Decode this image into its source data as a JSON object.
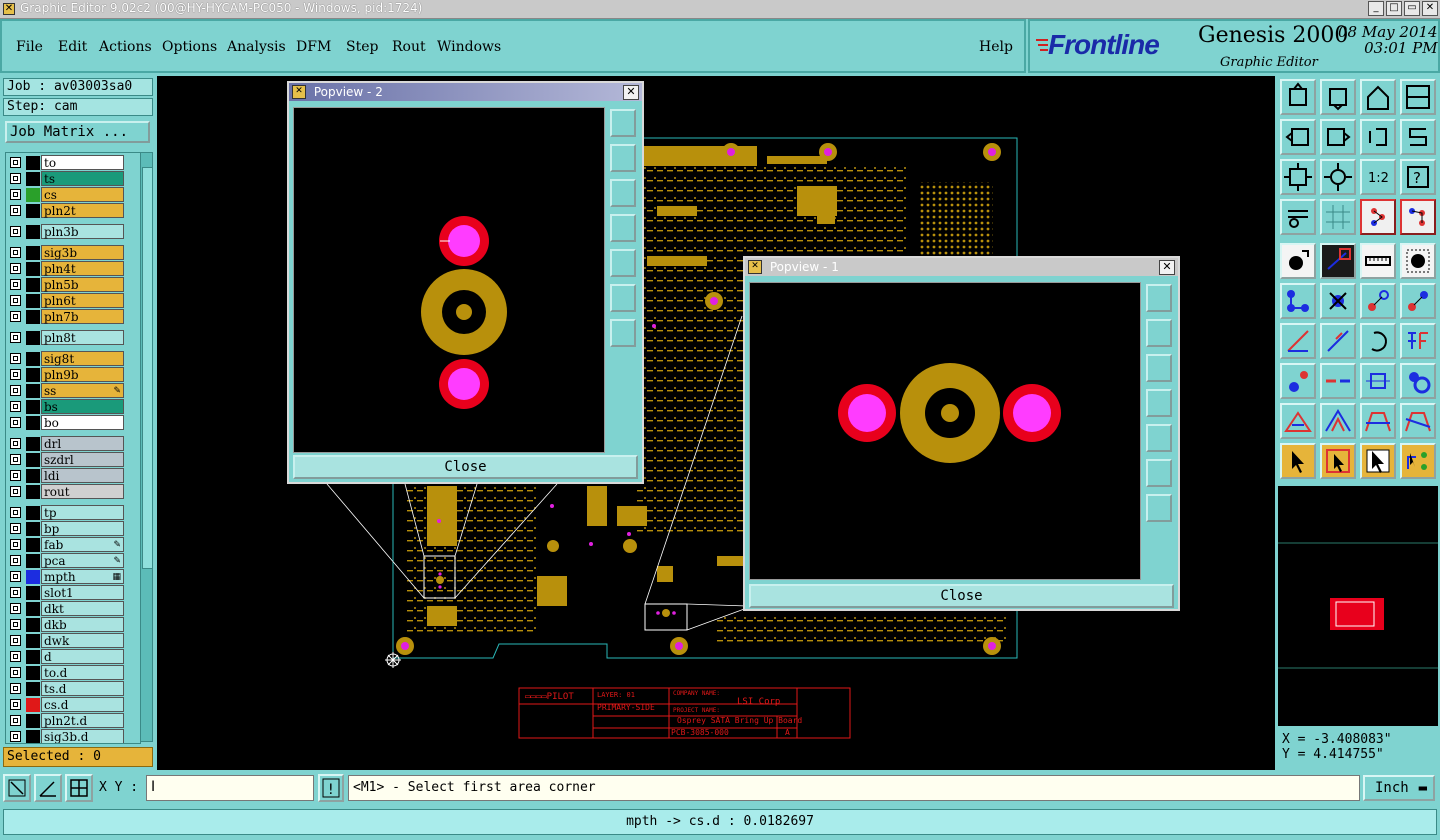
{
  "window": {
    "title": "Graphic Editor 9.02c2 (00@HY-HYCAM-PC050 - Windows, pid:1724)"
  },
  "menu": {
    "items": [
      "File",
      "Edit",
      "Actions",
      "Options",
      "Analysis",
      "DFM",
      "Step",
      "Rout",
      "Windows"
    ],
    "help": "Help"
  },
  "brand": {
    "logo": "Frontline",
    "product": "Genesis 2000",
    "subtitle": "Graphic Editor",
    "date": "08 May 2014",
    "time": "03:01 PM"
  },
  "job": {
    "job_label": "Job : av03003sa0",
    "step_label": "Step: cam",
    "matrix_button": "Job Matrix ..."
  },
  "layers": [
    {
      "name": "to",
      "color": "#ffffff",
      "swatch": ""
    },
    {
      "name": "ts",
      "color": "#1a9a7a",
      "swatch": ""
    },
    {
      "name": "cs",
      "color": "#e6b43a",
      "swatch": "#2aa02a"
    },
    {
      "name": "pln2t",
      "color": "#e6b43a",
      "swatch": ""
    },
    {
      "name": "pln3b",
      "color": "#a9e3e0",
      "swatch": ""
    },
    {
      "name": "sig3b",
      "color": "#e6b43a",
      "swatch": ""
    },
    {
      "name": "pln4t",
      "color": "#e6b43a",
      "swatch": ""
    },
    {
      "name": "pln5b",
      "color": "#e6b43a",
      "swatch": ""
    },
    {
      "name": "pln6t",
      "color": "#e6b43a",
      "swatch": ""
    },
    {
      "name": "pln7b",
      "color": "#e6b43a",
      "swatch": ""
    },
    {
      "name": "pln8t",
      "color": "#a9e3e0",
      "swatch": ""
    },
    {
      "name": "sig8t",
      "color": "#e6b43a",
      "swatch": ""
    },
    {
      "name": "pln9b",
      "color": "#e6b43a",
      "swatch": ""
    },
    {
      "name": "ss",
      "color": "#e6b43a",
      "swatch": "",
      "mark": "✎"
    },
    {
      "name": "bs",
      "color": "#1a9a7a",
      "swatch": ""
    },
    {
      "name": "bo",
      "color": "#ffffff",
      "swatch": ""
    },
    {
      "name": "drl",
      "color": "#b8c4cc",
      "swatch": ""
    },
    {
      "name": "szdrl",
      "color": "#b8c4cc",
      "swatch": ""
    },
    {
      "name": "ldi",
      "color": "#b8c4cc",
      "swatch": ""
    },
    {
      "name": "rout",
      "color": "#d0d0d0",
      "swatch": ""
    },
    {
      "name": "tp",
      "color": "#a9e3e0",
      "swatch": ""
    },
    {
      "name": "bp",
      "color": "#a9e3e0",
      "swatch": ""
    },
    {
      "name": "fab",
      "color": "#a9e3e0",
      "swatch": "",
      "mark": "✎"
    },
    {
      "name": "pca",
      "color": "#a9e3e0",
      "swatch": "",
      "mark": "✎"
    },
    {
      "name": "mpth",
      "color": "#a9e3e0",
      "swatch": "#1c2de0",
      "mark": "▦"
    },
    {
      "name": "slot1",
      "color": "#a9e3e0",
      "swatch": ""
    },
    {
      "name": "dkt",
      "color": "#a9e3e0",
      "swatch": ""
    },
    {
      "name": "dkb",
      "color": "#a9e3e0",
      "swatch": ""
    },
    {
      "name": "dwk",
      "color": "#a9e3e0",
      "swatch": ""
    },
    {
      "name": "d",
      "color": "#a9e3e0",
      "swatch": ""
    },
    {
      "name": "to.d",
      "color": "#a9e3e0",
      "swatch": ""
    },
    {
      "name": "ts.d",
      "color": "#a9e3e0",
      "swatch": ""
    },
    {
      "name": "cs.d",
      "color": "#a9e3e0",
      "swatch": "#e01818"
    },
    {
      "name": "pln2t.d",
      "color": "#a9e3e0",
      "swatch": ""
    },
    {
      "name": "sig3b.d",
      "color": "#a9e3e0",
      "swatch": ""
    }
  ],
  "selected": "Selected : 0",
  "popview2": {
    "title": "Popview - 2",
    "close": "Close"
  },
  "popview1": {
    "title": "Popview - 1",
    "close": "Close"
  },
  "titleblock": {
    "layer": "LAYER: 01",
    "side": "PRIMARY-SIDE",
    "company_label": "COMPANY NAME:",
    "company": "LSI Corp",
    "project_label": "PROJECT NAME:",
    "project": "Osprey SATA Bring Up Board",
    "part": "PCB-3085-000",
    "rev": "A"
  },
  "coords": {
    "x": "X = -3.408083\"",
    "y": "Y = 4.414755\""
  },
  "bottom": {
    "xy_label": "X Y :",
    "prompt": "<M1> - Select first area corner",
    "unit": "Inch"
  },
  "status": "mpth -> cs.d : 0.0182697"
}
